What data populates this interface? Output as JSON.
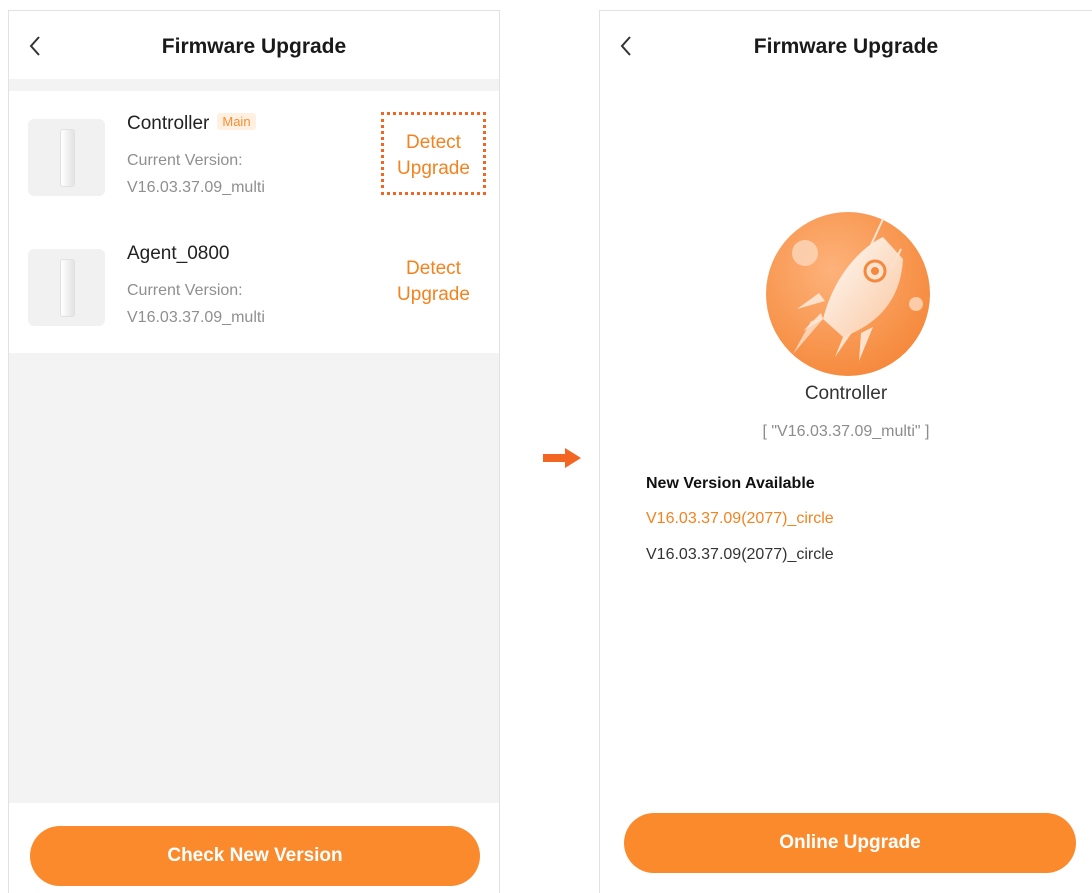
{
  "left_screen": {
    "title": "Firmware Upgrade",
    "devices": [
      {
        "name": "Controller",
        "badge": "Main",
        "version_label": "Current Version:",
        "version": "V16.03.37.09_multi",
        "action_line1": "Detect",
        "action_line2": "Upgrade"
      },
      {
        "name": "Agent_0800",
        "version_label": "Current Version:",
        "version": "V16.03.37.09_multi",
        "action_line1": "Detect",
        "action_line2": "Upgrade"
      }
    ],
    "button": "Check New Version"
  },
  "right_screen": {
    "title": "Firmware Upgrade",
    "device_name": "Controller",
    "current_version": "[ \"V16.03.37.09_multi\" ]",
    "new_version_title": "New Version Available",
    "new_version_highlight": "V16.03.37.09(2077)_circle",
    "new_version_plain": "V16.03.37.09(2077)_circle",
    "button": "Online Upgrade"
  },
  "icons": [
    "back-chevron-icon",
    "device-thumbnail-icon",
    "rocket-icon",
    "right-arrow-icon"
  ],
  "colors": {
    "accent": "#fa8a2c",
    "accent_text": "#f4821e",
    "highlight_box": "#f26522",
    "background": "#f3f3f3"
  }
}
